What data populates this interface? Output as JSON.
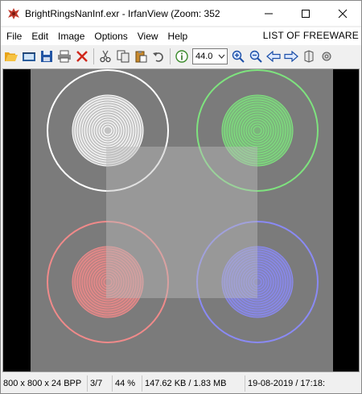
{
  "window": {
    "title": "BrightRingsNanInf.exr - IrfanView (Zoom: 352",
    "minimize_glyph": "—",
    "maximize_glyph": "☐",
    "close_glyph": "✕"
  },
  "menu": {
    "items": [
      "File",
      "Edit",
      "Image",
      "Options",
      "View",
      "Help"
    ],
    "banner": "LIST OF FREEWARE"
  },
  "toolbar": {
    "zoom_value": "44.0",
    "icons": [
      "open-folder-icon",
      "slideshow-icon",
      "save-icon",
      "print-icon",
      "delete-icon",
      "cut-icon",
      "copy-icon",
      "paste-icon",
      "undo-icon",
      "info-icon",
      "zoom-in-icon",
      "zoom-out-icon",
      "previous-icon",
      "next-icon",
      "settings-icon"
    ]
  },
  "status": {
    "dimensions": "800 x 800 x 24 BPP",
    "index": "3/7",
    "zoom": "44 %",
    "size": "147.62 KB / 1.83 MB",
    "datetime": "19-08-2019 / 17:18:"
  },
  "image": {
    "background": "#7b7b7b",
    "square_color": "#a8a8a8",
    "rings": [
      {
        "name": "white",
        "color": "#ffffff"
      },
      {
        "name": "green",
        "color": "#7ee37e"
      },
      {
        "name": "red",
        "color": "#f08a8a"
      },
      {
        "name": "blue",
        "color": "#8a8af5"
      }
    ]
  }
}
